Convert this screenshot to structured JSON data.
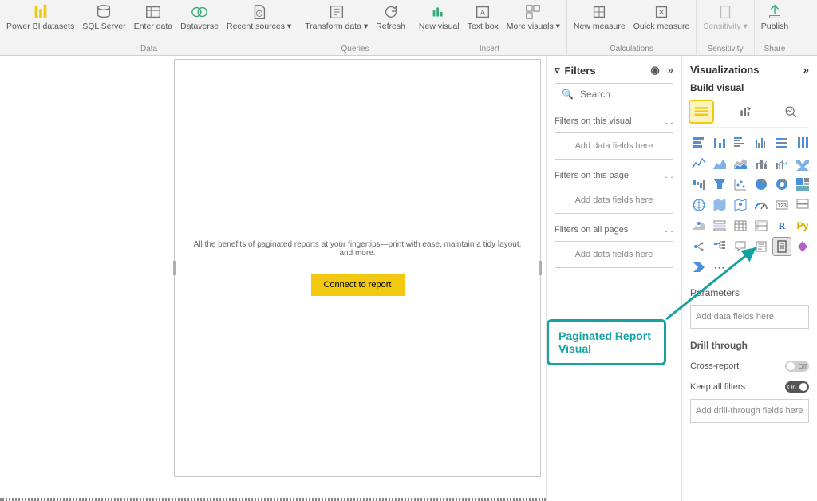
{
  "ribbon": {
    "groups": [
      {
        "label": "Data",
        "buttons": [
          {
            "label": "Power BI datasets",
            "ico": "pbi"
          },
          {
            "label": "SQL Server",
            "ico": "sql"
          },
          {
            "label": "Enter data",
            "ico": "enter"
          },
          {
            "label": "Dataverse",
            "ico": "dv"
          },
          {
            "label": "Recent sources ▾",
            "ico": "recent"
          }
        ]
      },
      {
        "label": "Queries",
        "buttons": [
          {
            "label": "Transform data ▾",
            "ico": "transform"
          },
          {
            "label": "Refresh",
            "ico": "refresh"
          }
        ]
      },
      {
        "label": "Insert",
        "buttons": [
          {
            "label": "New visual",
            "ico": "newvis"
          },
          {
            "label": "Text box",
            "ico": "textbox"
          },
          {
            "label": "More visuals ▾",
            "ico": "morevis"
          }
        ]
      },
      {
        "label": "Calculations",
        "buttons": [
          {
            "label": "New measure",
            "ico": "measure"
          },
          {
            "label": "Quick measure",
            "ico": "qmeasure"
          }
        ]
      },
      {
        "label": "Sensitivity",
        "buttons": [
          {
            "label": "Sensitivity ▾",
            "ico": "sens",
            "disabled": true
          }
        ]
      },
      {
        "label": "Share",
        "buttons": [
          {
            "label": "Publish",
            "ico": "publish"
          }
        ]
      }
    ]
  },
  "canvas": {
    "message": "All the benefits of paginated reports at your fingertips—print with ease, maintain a tidy layout, and more.",
    "connect_label": "Connect to report"
  },
  "filters": {
    "title": "Filters",
    "search_placeholder": "Search",
    "groups": [
      {
        "title": "Filters on this visual",
        "well": "Add data fields here"
      },
      {
        "title": "Filters on this page",
        "well": "Add data fields here"
      },
      {
        "title": "Filters on all pages",
        "well": "Add data fields here"
      }
    ]
  },
  "viz": {
    "title": "Visualizations",
    "subtitle": "Build visual",
    "parameters_label": "Parameters",
    "parameters_well": "Add data fields here",
    "drill_label": "Drill through",
    "cross_report_label": "Cross-report",
    "cross_report_state": "Off",
    "keep_all_label": "Keep all filters",
    "keep_all_state": "On",
    "drill_well": "Add drill-through fields here"
  },
  "annotation": {
    "text": "Paginated Report Visual"
  }
}
